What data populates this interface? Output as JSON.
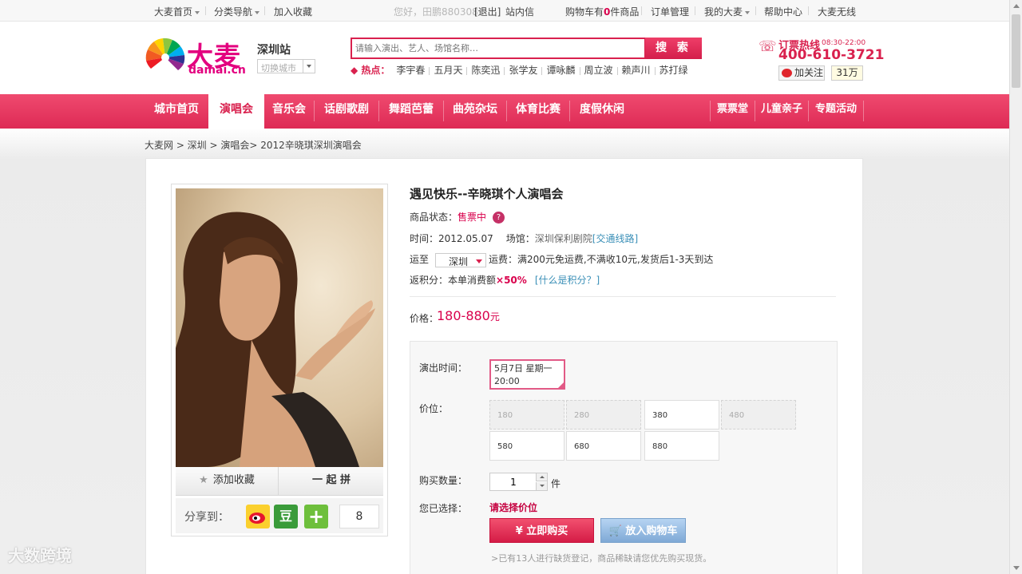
{
  "topbar": {
    "home": "大麦首页",
    "category_nav": "分类导航",
    "add_favorite": "加入收藏",
    "greeting": "您好，田鹏880308！",
    "logout": "[退出]",
    "messages": "站内信",
    "cart_prefix": "购物车有",
    "cart_count": "0",
    "cart_suffix": "件商品",
    "orders": "订单管理",
    "my_damai": "我的大麦",
    "help": "帮助中心",
    "wireless": "大麦无线"
  },
  "header": {
    "logo_cn": "大麦",
    "logo_en": "damai.cn",
    "city": "深圳站",
    "city_switch": "切换城市",
    "search_placeholder": "请输入演出、艺人、场馆名称…",
    "search_button": "搜 索",
    "hot_label": "热点：",
    "hot_items": [
      "李宇春",
      "五月天",
      "陈奕迅",
      "张学友",
      "谭咏麟",
      "周立波",
      "赖声川",
      "苏打绿"
    ],
    "hotline_label": "订票热线",
    "hotline_hours": "08:30-22:00",
    "hotline_number": "400-610-3721",
    "follow": "加关注",
    "follow_count": "31万"
  },
  "nav": {
    "items": [
      "城市首页",
      "演唱会",
      "音乐会",
      "话剧歌剧",
      "舞蹈芭蕾",
      "曲苑杂坛",
      "体育比赛",
      "度假休闲"
    ],
    "right_items": [
      "票票堂",
      "儿童亲子",
      "专题活动"
    ],
    "active": "演唱会"
  },
  "breadcrumb": "大麦网 > 深圳 > 演唱会> 2012辛晓琪深圳演唱会",
  "product": {
    "title": "遇见快乐--辛晓琪个人演唱会",
    "status_label": "商品状态：",
    "status": "售票中",
    "time_label": "时间：",
    "time": "2012.05.07",
    "venue_label": "场馆：",
    "venue": "深圳保利剧院",
    "route": "[交通线路]",
    "ship_label": "运至",
    "ship_city": "深圳",
    "shipping_label": "运费：",
    "shipping": "满200元免运费,不满收10元,发货后1-3天到达",
    "points_label": "返积分：",
    "points_text": "本单消费额",
    "points_value": "×50%",
    "points_help": "[什么是积分？]",
    "price_label": "价格：",
    "price": "180-880",
    "price_unit": "元"
  },
  "photo_actions": {
    "favorite": "添加收藏",
    "group": "一 起 拼",
    "share_label": "分享到：",
    "share_douban": "豆",
    "share_more": "+",
    "share_count": "8"
  },
  "buy": {
    "show_time_label": "演出时间：",
    "show_date": "5月7日 星期一",
    "show_hour": "20:00",
    "price_label": "价位：",
    "prices": [
      {
        "value": "180",
        "disabled": true
      },
      {
        "value": "280",
        "disabled": true
      },
      {
        "value": "380",
        "disabled": false
      },
      {
        "value": "480",
        "disabled": true
      },
      {
        "value": "580",
        "disabled": false
      },
      {
        "value": "680",
        "disabled": false
      },
      {
        "value": "880",
        "disabled": false
      }
    ],
    "qty_label": "购买数量：",
    "qty": "1",
    "unit": "件",
    "chosen_label": "您已选择：",
    "chosen": "请选择价位",
    "buy_now": "¥ 立即购买",
    "add_cart": "放入购物车",
    "note": ">已有13人进行缺货登记，商品稀缺请您优先购买现货。"
  },
  "watermark": "大数跨境",
  "colors": {
    "brand": "#d9214e",
    "price": "#d9004c",
    "link": "#3a8fb7"
  }
}
